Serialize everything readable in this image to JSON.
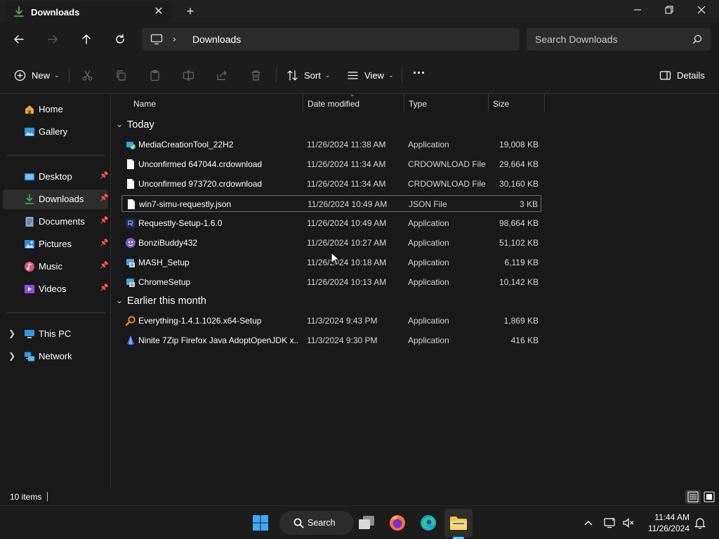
{
  "window": {
    "tab_title": "Downloads",
    "new_tab_symbol": "+",
    "close_tab_symbol": "✕"
  },
  "nav": {
    "breadcrumb_separator": "›",
    "breadcrumb": "Downloads",
    "search_placeholder": "Search Downloads"
  },
  "commands": {
    "new_label": "New",
    "sort_label": "Sort",
    "view_label": "View",
    "more_label": "···",
    "details_label": "Details"
  },
  "sidebar": {
    "items": [
      {
        "label": "Home",
        "icon": "home-icon"
      },
      {
        "label": "Gallery",
        "icon": "gallery-icon"
      },
      {
        "label": "Desktop",
        "icon": "desktop-icon",
        "pinned": true
      },
      {
        "label": "Downloads",
        "icon": "downloads-icon",
        "pinned": true,
        "active": true
      },
      {
        "label": "Documents",
        "icon": "documents-icon",
        "pinned": true
      },
      {
        "label": "Pictures",
        "icon": "pictures-icon",
        "pinned": true
      },
      {
        "label": "Music",
        "icon": "music-icon",
        "pinned": true
      },
      {
        "label": "Videos",
        "icon": "videos-icon",
        "pinned": true
      },
      {
        "label": "This PC",
        "icon": "this-pc-icon"
      },
      {
        "label": "Network",
        "icon": "network-icon"
      }
    ]
  },
  "columns": {
    "name": "Name",
    "date": "Date modified",
    "type": "Type",
    "size": "Size"
  },
  "groups": [
    {
      "label": "Today",
      "files": [
        {
          "name": "MediaCreationTool_22H2",
          "date": "11/26/2024 11:38 AM",
          "type": "Application",
          "size": "19,008 KB",
          "icon": "media-creation-icon"
        },
        {
          "name": "Unconfirmed 647044.crdownload",
          "date": "11/26/2024 11:34 AM",
          "type": "CRDOWNLOAD File",
          "size": "29,664 KB",
          "icon": "file-icon"
        },
        {
          "name": "Unconfirmed 973720.crdownload",
          "date": "11/26/2024 11:34 AM",
          "type": "CRDOWNLOAD File",
          "size": "30,160 KB",
          "icon": "file-icon"
        },
        {
          "name": "win7-simu-requestly.json",
          "date": "11/26/2024 10:49 AM",
          "type": "JSON File",
          "size": "3 KB",
          "icon": "file-icon"
        },
        {
          "name": "Requestly-Setup-1.6.0",
          "date": "11/26/2024 10:49 AM",
          "type": "Application",
          "size": "98,664 KB",
          "icon": "requestly-icon"
        },
        {
          "name": "BonziBuddy432",
          "date": "11/26/2024 10:27 AM",
          "type": "Application",
          "size": "51,102 KB",
          "icon": "bonzi-icon"
        },
        {
          "name": "MASH_Setup",
          "date": "11/26/2024 10:18 AM",
          "type": "Application",
          "size": "6,119 KB",
          "icon": "installer-icon"
        },
        {
          "name": "ChromeSetup",
          "date": "11/26/2024 10:13 AM",
          "type": "Application",
          "size": "10,142 KB",
          "icon": "installer-icon"
        }
      ]
    },
    {
      "label": "Earlier this month",
      "files": [
        {
          "name": "Everything-1.4.1.1026.x64-Setup",
          "date": "11/3/2024 9:43 PM",
          "type": "Application",
          "size": "1,869 KB",
          "icon": "magnifier-app-icon"
        },
        {
          "name": "Ninite 7Zip Firefox Java AdoptOpenJDK x...",
          "date": "11/3/2024 9:30 PM",
          "type": "Application",
          "size": "416 KB",
          "icon": "ninite-icon"
        }
      ]
    }
  ],
  "status": {
    "item_count": "10 items"
  },
  "taskbar": {
    "search_label": "Search",
    "time": "11:44 AM",
    "date": "11/26/2024"
  },
  "colors": {
    "accent": "#60cdff",
    "folder_yellow": "#f4c542",
    "download_green": "#4caf50"
  }
}
